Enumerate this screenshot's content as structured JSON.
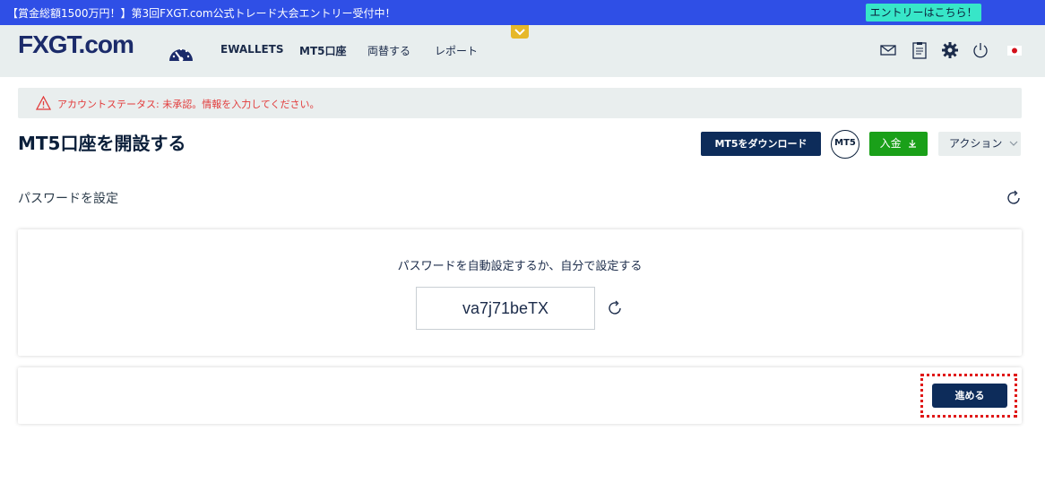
{
  "promo": {
    "text": "【賞金総額1500万円！】第3回FXGT.com公式トレード大会エントリー受付中！",
    "button": "エントリーはこちら！"
  },
  "nav": {
    "logo": "FXGT.com",
    "items": [
      "EWALLETS",
      "MT5口座",
      "両替する",
      "レポート"
    ],
    "icons": [
      "dashboard-icon",
      "mail-icon",
      "clipboard-icon",
      "gear-icon",
      "power-icon",
      "japan-flag-icon"
    ]
  },
  "alert": {
    "text": "アカウントステータス: 未承認。情報を入力してください。",
    "color": "#e23b3b"
  },
  "page": {
    "title": "MT5口座を開設する"
  },
  "actions": {
    "download": "MT5をダウンロード",
    "mt5": "MT5",
    "deposit": "入金",
    "action": "アクション"
  },
  "section": {
    "label": "パスワードを設定"
  },
  "password": {
    "caption": "パスワードを自動設定するか、自分で設定する",
    "value": "va7j71beTX"
  },
  "footer": {
    "next": "進める"
  },
  "colors": {
    "primary": "#0d2c5a",
    "banner": "#2f4fe6",
    "accent": "#37e6c8",
    "deposit": "#1aa019",
    "highlight": "#e01818"
  }
}
